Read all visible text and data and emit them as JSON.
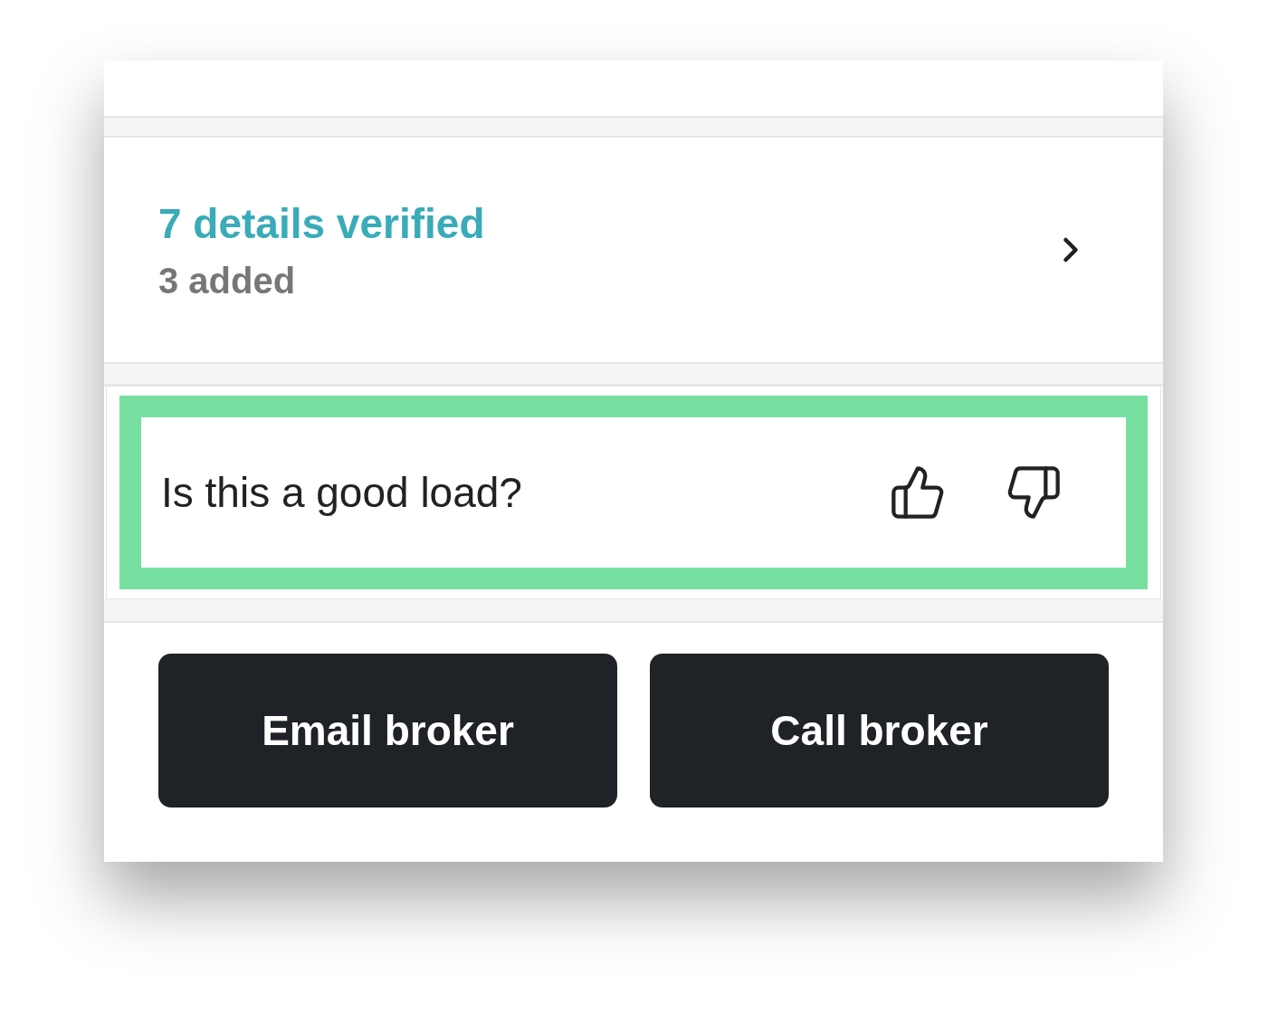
{
  "details": {
    "title": "7 details verified",
    "subtitle": "3 added"
  },
  "feedback": {
    "question": "Is this a good load?",
    "highlighted": true
  },
  "actions": [
    {
      "label": "Email broker"
    },
    {
      "label": "Call broker"
    }
  ]
}
